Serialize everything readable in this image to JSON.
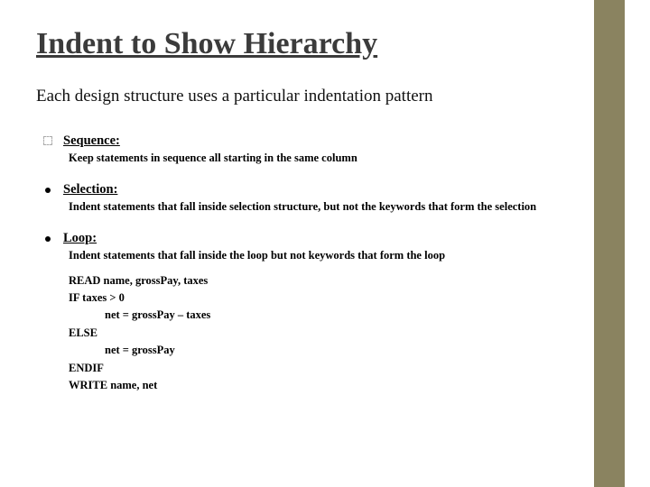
{
  "title": "Indent to Show Hierarchy",
  "intro": "Each design structure uses a particular indentation pattern",
  "sections": {
    "sequence": {
      "head": "Sequence:",
      "desc": "Keep statements in sequence all starting in the same column"
    },
    "selection": {
      "head": "Selection:",
      "desc": "Indent statements that fall inside selection structure, but not the keywords that form the selection"
    },
    "loop": {
      "head": "Loop:",
      "desc": "Indent statements that fall inside the loop but not keywords that form the loop"
    }
  },
  "code": {
    "l1": "READ name, grossPay, taxes",
    "l2": "IF taxes > 0",
    "l3": "net = grossPay – taxes",
    "l4": "ELSE",
    "l5": "net = grossPay",
    "l6": "ENDIF",
    "l7": "WRITE name, net"
  }
}
